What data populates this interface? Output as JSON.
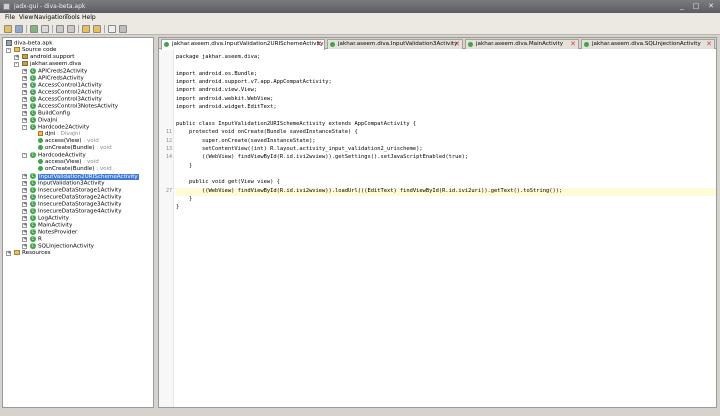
{
  "window": {
    "title": "jadx-gui - diva-beta.apk",
    "min": "_",
    "max": "□",
    "close": "✕"
  },
  "menu": [
    "File",
    "View",
    "Navigation",
    "Tools",
    "Help"
  ],
  "toolbar": [
    "open-icon",
    "save-icon",
    "sync-icon",
    "expand-icon",
    "back-icon",
    "forward-icon",
    "search-icon",
    "find-icon",
    "log-icon",
    "settings-icon"
  ],
  "tree": {
    "root": "diva-beta.apk",
    "source_code": "Source code",
    "pkg_support": "android.support",
    "pkg_main": "jakhar.aseem.diva",
    "items": [
      {
        "label": "APICreds2Activity"
      },
      {
        "label": "APICredsActivity"
      },
      {
        "label": "AccessControl1Activity"
      },
      {
        "label": "AccessControl2Activity"
      },
      {
        "label": "AccessControl3Activity"
      },
      {
        "label": "AccessControl3NotesActivity"
      },
      {
        "label": "BuildConfig"
      },
      {
        "label": "DivaJni"
      }
    ],
    "hardcode2": "Hardcode2Activity",
    "hardcode2_children": [
      {
        "label": "djni",
        "type": ": DivaJni"
      },
      {
        "label": "access(View)",
        "type": ": void"
      },
      {
        "label": "onCreate(Bundle)",
        "type": ": void"
      }
    ],
    "hardcode": "HardcodeActivity",
    "hardcode_children": [
      {
        "label": "access(View)",
        "type": ": void"
      },
      {
        "label": "onCreate(Bundle)",
        "type": ": void"
      }
    ],
    "selected": "InputValidation2URISchemeActivity",
    "items2": [
      {
        "label": "InputValidation3Activity"
      },
      {
        "label": "InsecureDataStorage1Activity"
      },
      {
        "label": "InsecureDataStorage2Activity"
      },
      {
        "label": "InsecureDataStorage3Activity"
      },
      {
        "label": "InsecureDataStorage4Activity"
      },
      {
        "label": "LogActivity"
      },
      {
        "label": "MainActivity"
      },
      {
        "label": "NotesProvider"
      },
      {
        "label": "R"
      },
      {
        "label": "SQLInjectionActivity"
      }
    ],
    "resources": "Resources"
  },
  "tabs": [
    {
      "label": "jakhar.aseem.diva.InputValidation2URISchemeActivity"
    },
    {
      "label": "jakhar.aseem.diva.InputValidation3Activity"
    },
    {
      "label": "jakhar.aseem.diva.MainActivity"
    },
    {
      "label": "jakhar.aseem.diva.SQLInjectionActivity"
    }
  ],
  "tab_close": "✕",
  "code": [
    {
      "num": "",
      "text": "package jakhar.aseem.diva;"
    },
    {
      "num": "",
      "text": ""
    },
    {
      "num": "",
      "text": "import android.os.Bundle;"
    },
    {
      "num": "",
      "text": "import android.support.v7.app.AppCompatActivity;"
    },
    {
      "num": "",
      "text": "import android.view.View;"
    },
    {
      "num": "",
      "text": "import android.webkit.WebView;"
    },
    {
      "num": "",
      "text": "import android.widget.EditText;"
    },
    {
      "num": "",
      "text": ""
    },
    {
      "num": "",
      "text": "public class InputValidation2URISchemeActivity extends AppCompatActivity {"
    },
    {
      "num": "11",
      "text": "    protected void onCreate(Bundle savedInstanceState) {"
    },
    {
      "num": "12",
      "text": "        super.onCreate(savedInstanceState);"
    },
    {
      "num": "13",
      "text": "        setContentView((int) R.layout.activity_input_validation2_urischeme);"
    },
    {
      "num": "14",
      "text": "        ((WebView) findViewById(R.id.ivi2wview)).getSettings().setJavaScriptEnabled(true);"
    },
    {
      "num": "",
      "text": "    }"
    },
    {
      "num": "",
      "text": ""
    },
    {
      "num": "",
      "text": "    public void get(View view) {"
    },
    {
      "num": "27",
      "text": "        ((WebView) findViewById(R.id.ivi2wview)).loadUrl(((EditText) findViewById(R.id.ivi2uri)).getText().toString());"
    },
    {
      "num": "",
      "text": "    }"
    },
    {
      "num": "",
      "text": "}"
    }
  ]
}
